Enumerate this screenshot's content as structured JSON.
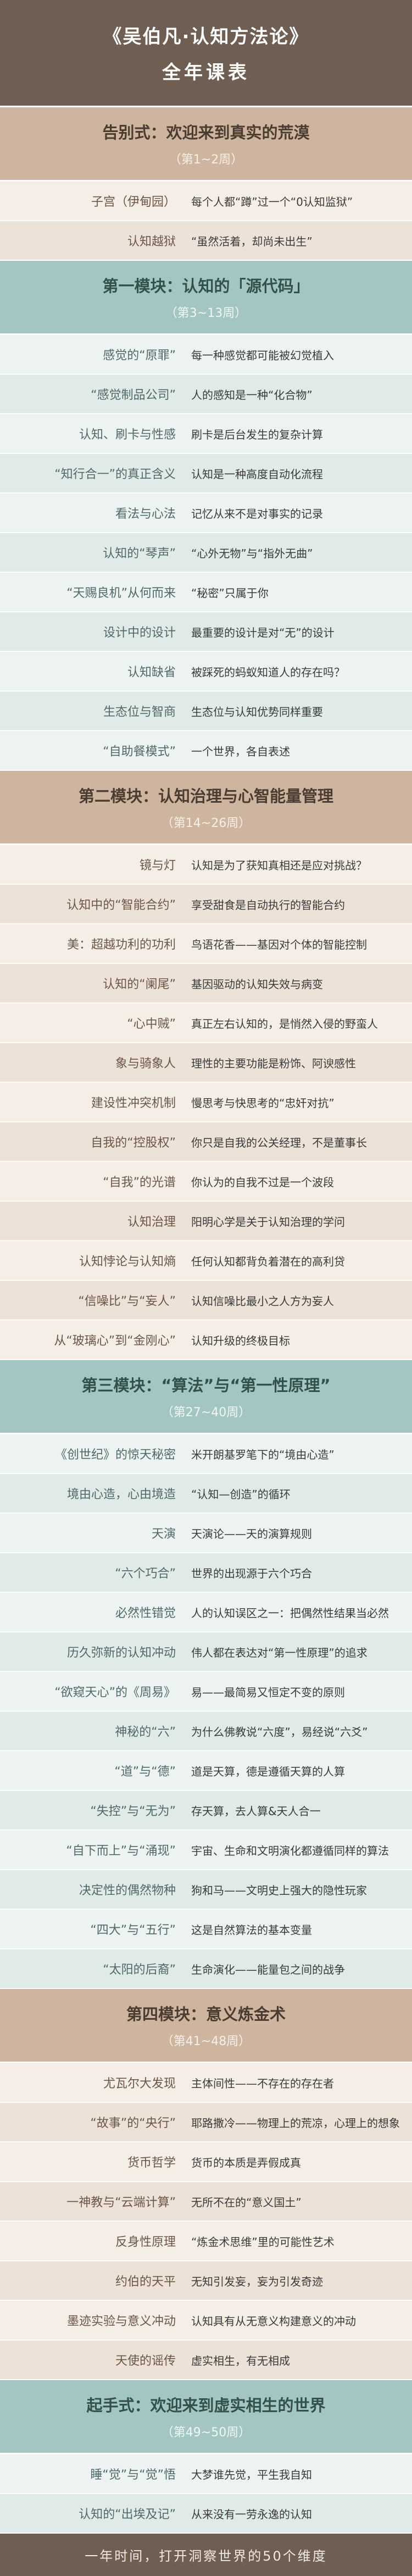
{
  "header": {
    "title": "《吴伯凡·认知方法论》",
    "subtitle": "全年课表"
  },
  "palette": {
    "banner_bg": "#6f5e52",
    "tan": "#cdb59f",
    "teal": "#a3c6c2"
  },
  "sections": [
    {
      "title": "告别式：欢迎来到真实的荒漠",
      "weeks": "（第1~2周）",
      "header_bg": "#cdb59f",
      "row_bg": "#f5eee6",
      "row_bg_alt": "#ede2d7",
      "rows": [
        {
          "topic": "子宫（伊甸园）",
          "desc": "每个人都“蹲”过一个“0认知监狱”"
        },
        {
          "topic": "认知越狱",
          "desc": "“虽然活着，却尚未出生”"
        }
      ]
    },
    {
      "title": "第一模块：认知的「源代码」",
      "weeks": "（第3~13周）",
      "header_bg": "#a3c6c2",
      "row_bg": "#ecf3f2",
      "row_bg_alt": "#e0ebe9",
      "rows": [
        {
          "topic": "感觉的“原罪”",
          "desc": "每一种感觉都可能被幻觉植入"
        },
        {
          "topic": "“感觉制品公司”",
          "desc": "人的感知是一种“化合物”"
        },
        {
          "topic": "认知、刷卡与性感",
          "desc": "刷卡是后台发生的复杂计算"
        },
        {
          "topic": "“知行合一”的真正含义",
          "desc": "认知是一种高度自动化流程"
        },
        {
          "topic": "看法与心法",
          "desc": "记忆从来不是对事实的记录"
        },
        {
          "topic": "认知的“琴声”",
          "desc": "“心外无物”与“指外无曲”"
        },
        {
          "topic": "“天赐良机”从何而来",
          "desc": "“秘密”只属于你"
        },
        {
          "topic": "设计中的设计",
          "desc": "最重要的设计是对“无”的设计"
        },
        {
          "topic": "认知缺省",
          "desc": "被踩死的蚂蚁知道人的存在吗？"
        },
        {
          "topic": "生态位与智商",
          "desc": "生态位与认知优势同样重要"
        },
        {
          "topic": "“自助餐模式”",
          "desc": "一个世界，各自表述"
        }
      ]
    },
    {
      "title": "第二模块：认知治理与心智能量管理",
      "weeks": "（第14~26周）",
      "header_bg": "#cdb59f",
      "row_bg": "#f5eee6",
      "row_bg_alt": "#ede2d7",
      "rows": [
        {
          "topic": "镜与灯",
          "desc": "认知是为了获知真相还是应对挑战？"
        },
        {
          "topic": "认知中的“智能合约”",
          "desc": "享受甜食是自动执行的智能合约"
        },
        {
          "topic": "美：超越功利的功利",
          "desc": "鸟语花香——基因对个体的智能控制"
        },
        {
          "topic": "认知的“阑尾”",
          "desc": "基因驱动的认知失效与病变"
        },
        {
          "topic": "“心中贼”",
          "desc": "真正左右认知的，是悄然入侵的野蛮人"
        },
        {
          "topic": "象与骑象人",
          "desc": "理性的主要功能是粉饰、阿谀感性"
        },
        {
          "topic": "建设性冲突机制",
          "desc": "慢思考与快思考的“忠奸对抗”"
        },
        {
          "topic": "自我的“控股权”",
          "desc": "你只是自我的公关经理，不是董事长"
        },
        {
          "topic": "“自我”的光谱",
          "desc": "你认为的自我不过是一个波段"
        },
        {
          "topic": "认知治理",
          "desc": "阳明心学是关于认知治理的学问"
        },
        {
          "topic": "认知悖论与认知熵",
          "desc": "任何认知都背负着潜在的高利贷"
        },
        {
          "topic": "“信噪比”与“妄人”",
          "desc": "认知信噪比最小之人方为妄人"
        },
        {
          "topic": "从“玻璃心”到“金刚心”",
          "desc": "认知升级的终极目标"
        }
      ]
    },
    {
      "title": "第三模块：“算法”与“第一性原理”",
      "weeks": "（第27~40周）",
      "header_bg": "#a3c6c2",
      "row_bg": "#ecf3f2",
      "row_bg_alt": "#e0ebe9",
      "rows": [
        {
          "topic": "《创世纪》的惊天秘密",
          "desc": "米开朗基罗笔下的“境由心造”"
        },
        {
          "topic": "境由心造，心由境造",
          "desc": "“认知—创造”的循环"
        },
        {
          "topic": "天演",
          "desc": "天演论——天的演算规则"
        },
        {
          "topic": "“六个巧合”",
          "desc": "世界的出现源于六个巧合"
        },
        {
          "topic": "必然性错觉",
          "desc": "人的认知误区之一：把偶然性结果当必然"
        },
        {
          "topic": "历久弥新的认知冲动",
          "desc": "伟人都在表达对“第一性原理”的追求"
        },
        {
          "topic": "“欲窥天心”的《周易》",
          "desc": "易——最简易又恒定不变的原则"
        },
        {
          "topic": "神秘的“六”",
          "desc": "为什么佛教说“六度”，易经说“六爻”"
        },
        {
          "topic": "“道”与“德”",
          "desc": "道是天算，德是遵循天算的人算"
        },
        {
          "topic": "“失控”与“无为”",
          "desc": "存天算，去人算&天人合一"
        },
        {
          "topic": "“自下而上”与“涌现”",
          "desc": "宇宙、生命和文明演化都遵循同样的算法"
        },
        {
          "topic": "决定性的偶然物种",
          "desc": "狗和马——文明史上强大的隐性玩家"
        },
        {
          "topic": "“四大”与“五行”",
          "desc": "这是自然算法的基本变量"
        },
        {
          "topic": "“太阳的后裔”",
          "desc": "生命演化——能量包之间的战争"
        }
      ]
    },
    {
      "title": "第四模块：意义炼金术",
      "weeks": "（第41~48周）",
      "header_bg": "#cdb59f",
      "row_bg": "#f5eee6",
      "row_bg_alt": "#ede2d7",
      "rows": [
        {
          "topic": "尤瓦尔大发现",
          "desc": "主体间性——不存在的存在者"
        },
        {
          "topic": "“故事”的“央行”",
          "desc": "耶路撒冷——物理上的荒凉，心理上的想象"
        },
        {
          "topic": "货币哲学",
          "desc": "货币的本质是弄假成真"
        },
        {
          "topic": "一神教与“云端计算”",
          "desc": "无所不在的“意义国土”"
        },
        {
          "topic": "反身性原理",
          "desc": "“炼金术思维”里的可能性艺术"
        },
        {
          "topic": "约伯的天平",
          "desc": "无知引发妄，妄为引发奇迹"
        },
        {
          "topic": "墨迹实验与意义冲动",
          "desc": "认知具有从无意义构建意义的冲动"
        },
        {
          "topic": "天使的谣传",
          "desc": "虚实相生，有无相成"
        }
      ]
    },
    {
      "title": "起手式：欢迎来到虚实相生的世界",
      "weeks": "（第49~50周）",
      "header_bg": "#a3c6c2",
      "row_bg": "#ecf3f2",
      "row_bg_alt": "#e0ebe9",
      "rows": [
        {
          "topic": "睡“觉”与“觉”悟",
          "desc": "大梦谁先觉，平生我自知"
        },
        {
          "topic": "认知的“出埃及记”",
          "desc": "从来没有一劳永逸的认知"
        }
      ]
    }
  ],
  "footer": {
    "tagline": "一年时间，打开洞察世界的50个维度"
  }
}
